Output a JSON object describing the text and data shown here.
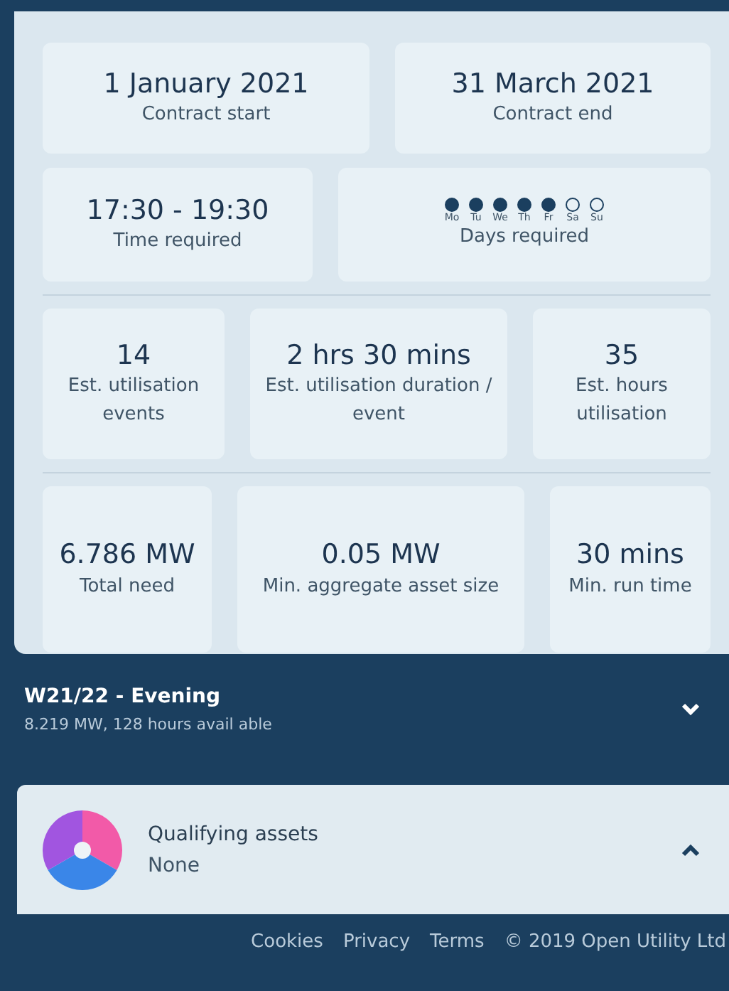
{
  "contract": [
    {
      "value": "1 January 2021",
      "label": "Contract start"
    },
    {
      "value": "31 March 2021",
      "label": "Contract end"
    }
  ],
  "time_required": {
    "value": "17:30 - 19:30",
    "label": "Time required"
  },
  "days_required": {
    "label": "Days required",
    "days": [
      {
        "label": "Mo",
        "selected": true
      },
      {
        "label": "Tu",
        "selected": true
      },
      {
        "label": "We",
        "selected": true
      },
      {
        "label": "Th",
        "selected": true
      },
      {
        "label": "Fr",
        "selected": true
      },
      {
        "label": "Sa",
        "selected": false
      },
      {
        "label": "Su",
        "selected": false
      }
    ]
  },
  "utilisation": [
    {
      "value": "14",
      "label": "Est. utilisation events"
    },
    {
      "value": "2 hrs 30 mins",
      "label": "Est. utilisation duration / event"
    },
    {
      "value": "35",
      "label": "Est. hours utilisation"
    }
  ],
  "requirements": [
    {
      "value": "6.786 MW",
      "label": "Total need"
    },
    {
      "value": "0.05 MW",
      "label": "Min. aggregate asset size"
    },
    {
      "value": "30 mins",
      "label": "Min. run time"
    }
  ],
  "window": {
    "title": "W21/22 - Evening",
    "subtitle": "8.219 MW, 128 hours avail able",
    "expanded": false
  },
  "assets": {
    "title": "Qualifying assets",
    "value": "None",
    "expanded": true
  },
  "footer": {
    "links": [
      "Cookies",
      "Privacy",
      "Terms"
    ],
    "copyright": "© 2019 Open Utility Ltd"
  }
}
